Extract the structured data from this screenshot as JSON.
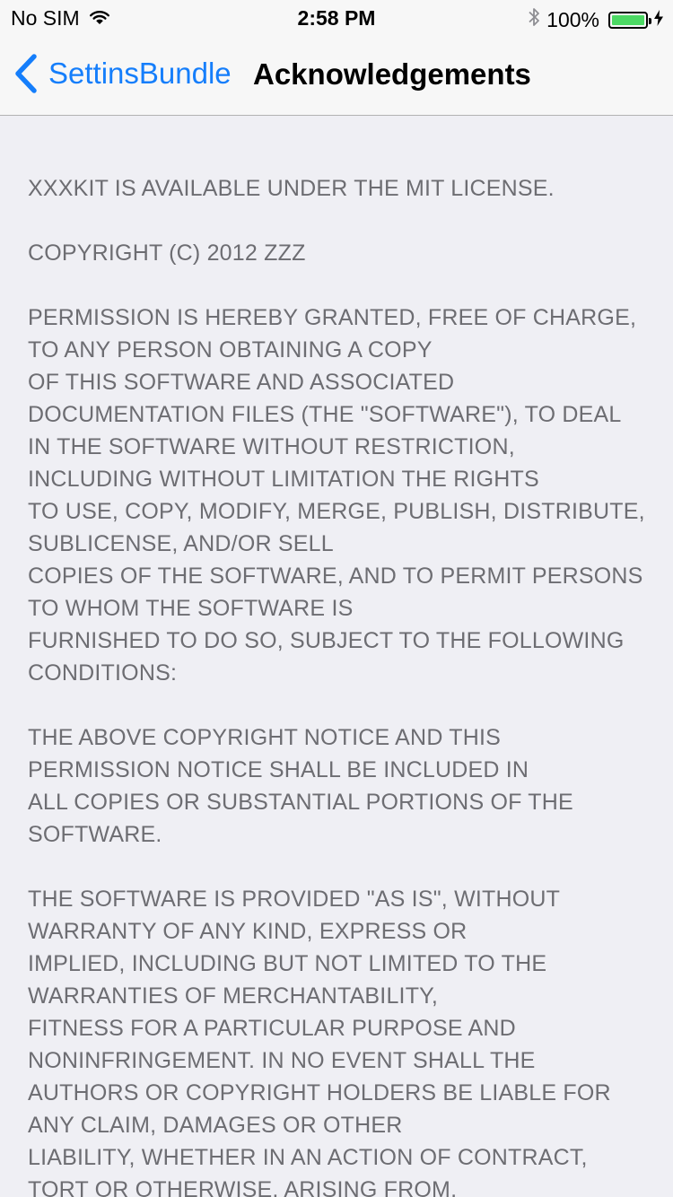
{
  "status_bar": {
    "carrier": "No SIM",
    "time": "2:58 PM",
    "battery_percent": "100%",
    "battery_level": 1.0,
    "icons": [
      "wifi-icon",
      "bluetooth-icon",
      "battery-icon",
      "charging-bolt-icon"
    ]
  },
  "nav": {
    "back_label": "SettinsBundle",
    "title": "Acknowledgements",
    "accent_color": "#157efb"
  },
  "license": {
    "paragraphs": [
      [
        "XXXKIT IS AVAILABLE UNDER THE MIT LICENSE."
      ],
      [
        "COPYRIGHT (C) 2012 ZZZ"
      ],
      [
        "PERMISSION IS HEREBY GRANTED, FREE OF CHARGE,",
        "TO ANY PERSON OBTAINING A COPY",
        "OF THIS SOFTWARE AND ASSOCIATED",
        "DOCUMENTATION FILES (THE \"SOFTWARE\"), TO DEAL",
        "IN THE SOFTWARE WITHOUT RESTRICTION,",
        "INCLUDING WITHOUT LIMITATION THE RIGHTS",
        "TO USE, COPY, MODIFY, MERGE, PUBLISH, DISTRIBUTE,",
        "SUBLICENSE, AND/OR SELL",
        "COPIES OF THE SOFTWARE, AND TO PERMIT PERSONS",
        "TO WHOM THE SOFTWARE IS",
        "FURNISHED TO DO SO, SUBJECT TO THE FOLLOWING",
        "CONDITIONS:"
      ],
      [
        "THE ABOVE COPYRIGHT NOTICE AND THIS",
        "PERMISSION NOTICE SHALL BE INCLUDED IN",
        "ALL COPIES OR SUBSTANTIAL PORTIONS OF THE",
        "SOFTWARE."
      ],
      [
        "THE SOFTWARE IS PROVIDED \"AS IS\", WITHOUT",
        "WARRANTY OF ANY KIND, EXPRESS OR",
        "IMPLIED, INCLUDING BUT NOT LIMITED TO THE",
        "WARRANTIES OF MERCHANTABILITY,",
        "FITNESS FOR A PARTICULAR PURPOSE AND",
        "NONINFRINGEMENT. IN NO EVENT SHALL THE",
        "AUTHORS OR COPYRIGHT HOLDERS BE LIABLE FOR",
        "ANY CLAIM, DAMAGES OR OTHER",
        "LIABILITY, WHETHER IN AN ACTION OF CONTRACT,",
        "TORT OR OTHERWISE, ARISING FROM,"
      ]
    ]
  }
}
